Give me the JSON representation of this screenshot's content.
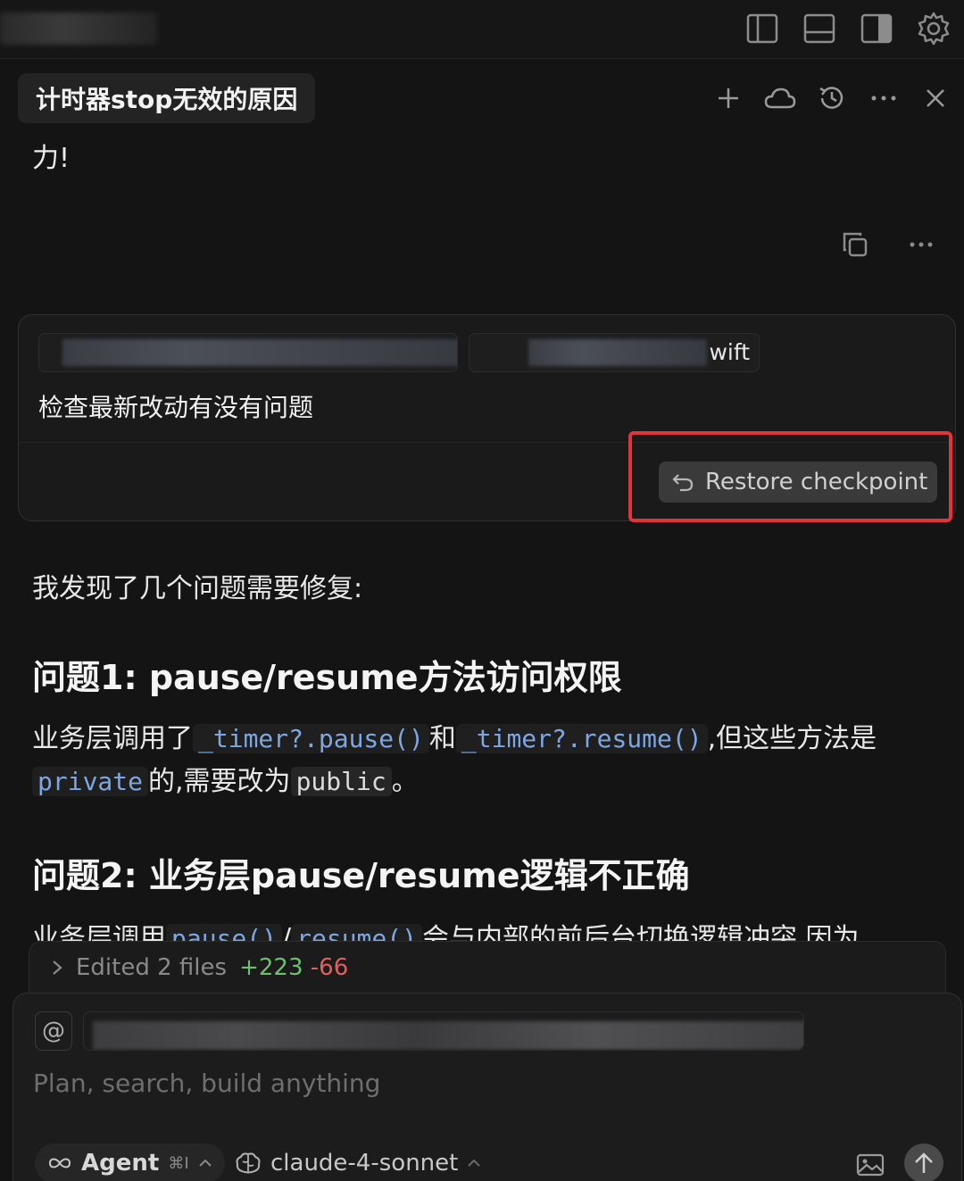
{
  "topbar": {
    "icons": [
      "sidebar-left-icon",
      "panel-bottom-icon",
      "sidebar-right-icon",
      "gear-icon"
    ]
  },
  "chat": {
    "title": "计时器stop无效的原因",
    "actions": [
      "plus-icon",
      "cloud-icon",
      "history-icon",
      "more-icon",
      "close-icon"
    ],
    "previous_fragment": "力!"
  },
  "user_message": {
    "chip2_suffix": "wift",
    "text": "检查最新改动有没有问题",
    "restore_label": "Restore checkpoint"
  },
  "response": {
    "intro": "我发现了几个问题需要修复:",
    "issue1": {
      "title": "问题1: pause/resume方法访问权限",
      "text_a": "业务层调用了",
      "code_a": "_timer?.pause()",
      "text_b": "和",
      "code_b": "_timer?.resume()",
      "text_c": ",但这些方法是",
      "code_c": "private",
      "text_d": "的,需要改为",
      "code_d": "public",
      "text_e": "。"
    },
    "issue2": {
      "title": "问题2: 业务层pause/resume逻辑不正确",
      "text_a": "业务层调用",
      "code_a": "pause()",
      "text_b": "/",
      "code_b": "resume()",
      "text_c": "会与内部的前后台切换逻辑冲突,因为"
    }
  },
  "edited": {
    "label": "Edited 2 files",
    "additions": "+223",
    "deletions": "-66"
  },
  "composer": {
    "at_symbol": "@",
    "placeholder": "Plan, search, build anything",
    "mode_label": "Agent",
    "mode_shortcut": "⌘I",
    "model_label": "claude-4-sonnet"
  },
  "colors": {
    "background": "#141414",
    "code_blue": "#7ea6e0",
    "additions": "#6cc070",
    "deletions": "#e06060",
    "highlight_red": "#e0353a"
  }
}
